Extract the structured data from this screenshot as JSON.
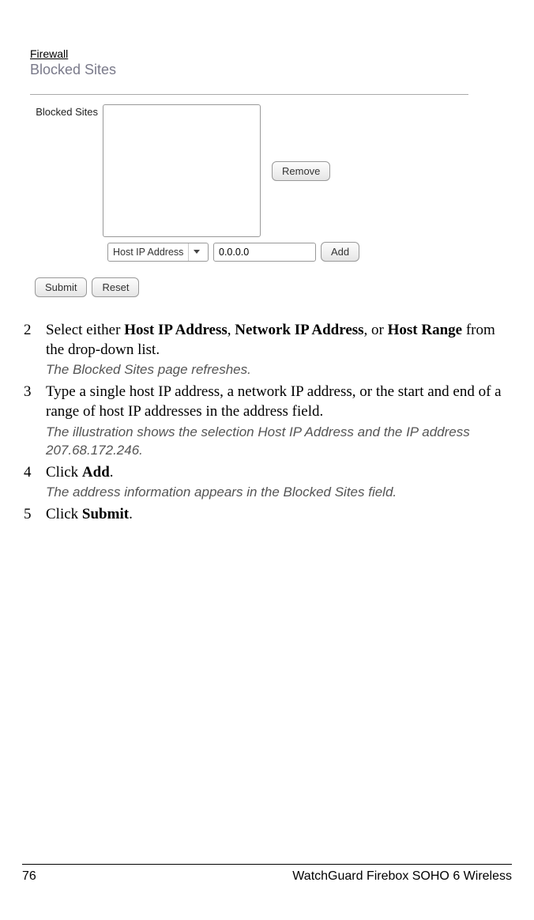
{
  "screenshot": {
    "breadcrumb": "Firewall",
    "title": "Blocked Sites",
    "listbox_label": "Blocked Sites",
    "remove_label": "Remove",
    "dropdown_selected": "Host IP Address",
    "ip_value": "0.0.0.0",
    "add_label": "Add",
    "submit_label": "Submit",
    "reset_label": "Reset"
  },
  "steps": {
    "s2": {
      "num": "2",
      "t1": "Select either ",
      "b1": "Host IP Address",
      "t2": ", ",
      "b2": "Network IP Address",
      "t3": ", or ",
      "b3": "Host Range",
      "t4": " from the drop-down list.",
      "note": "The Blocked Sites page refreshes."
    },
    "s3": {
      "num": "3",
      "text": "Type a single host IP address, a network IP address, or the start and end of a range of host IP addresses in the address field.",
      "note": "The illustration shows the selection Host IP Address and the IP address 207.68.172.246."
    },
    "s4": {
      "num": "4",
      "t1": "Click ",
      "b1": "Add",
      "t2": ".",
      "note": "The address information appears in the Blocked Sites field."
    },
    "s5": {
      "num": "5",
      "t1": "Click ",
      "b1": "Submit",
      "t2": "."
    }
  },
  "footer": {
    "page": "76",
    "title": "WatchGuard Firebox SOHO 6 Wireless"
  }
}
